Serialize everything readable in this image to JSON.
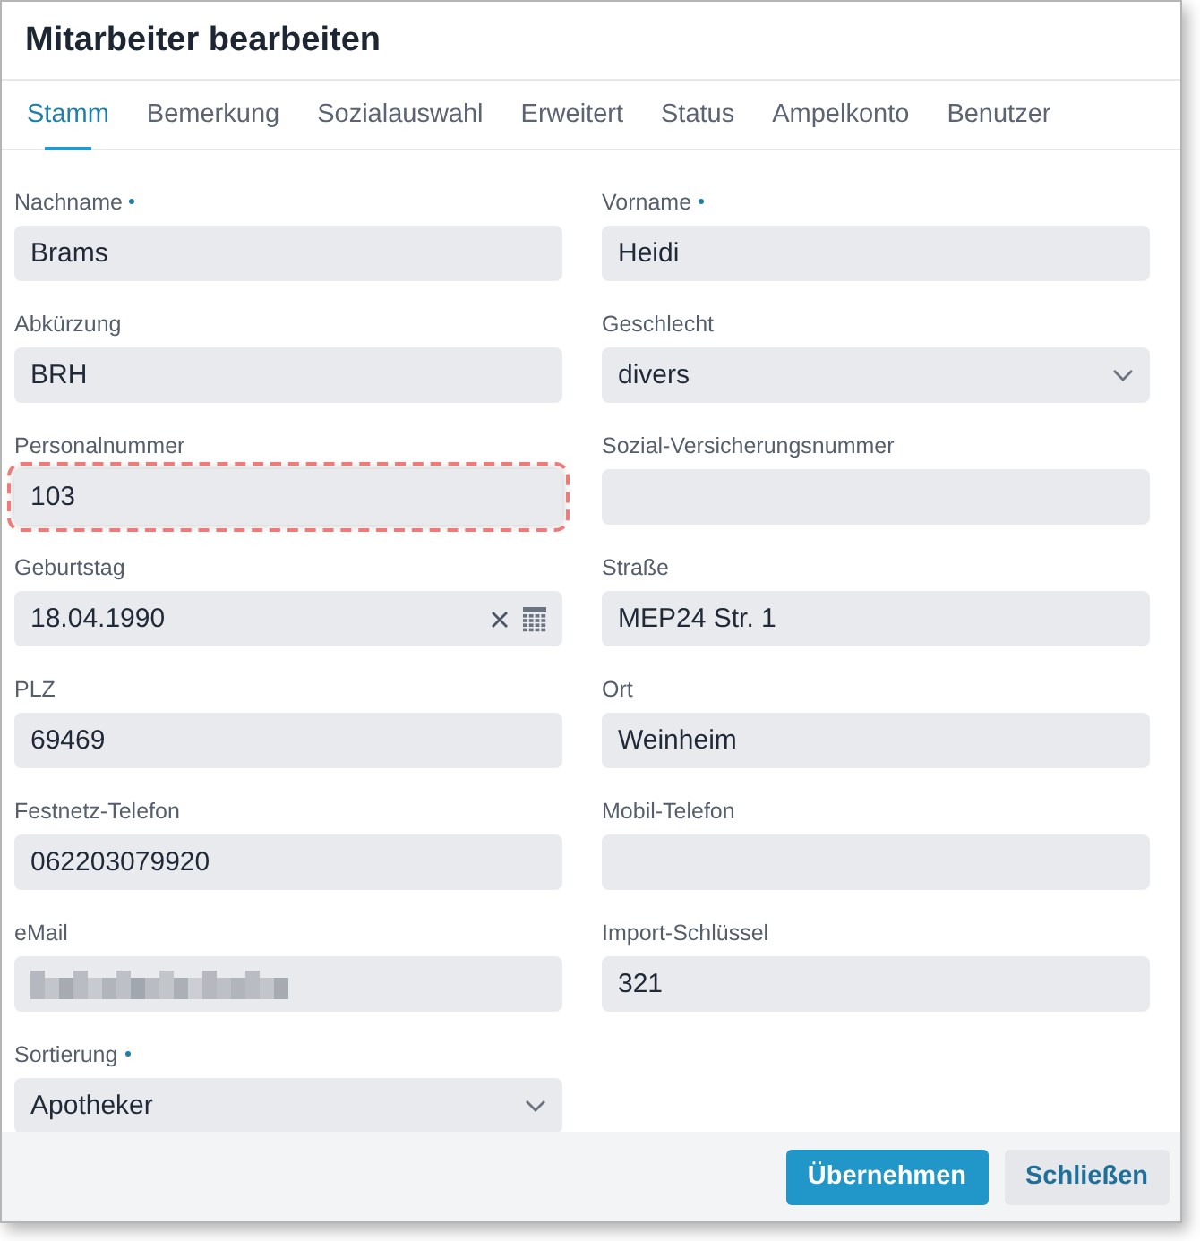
{
  "window": {
    "title": "Mitarbeiter bearbeiten"
  },
  "tabs": [
    {
      "label": "Stamm",
      "selected": true
    },
    {
      "label": "Bemerkung",
      "selected": false
    },
    {
      "label": "Sozialauswahl",
      "selected": false
    },
    {
      "label": "Erweitert",
      "selected": false
    },
    {
      "label": "Status",
      "selected": false
    },
    {
      "label": "Ampelkonto",
      "selected": false
    },
    {
      "label": "Benutzer",
      "selected": false
    }
  ],
  "fields": [
    {
      "label": "Nachname",
      "required": true,
      "kind": "text",
      "value": "Brams",
      "highlighted": false
    },
    {
      "label": "Vorname",
      "required": true,
      "kind": "text",
      "value": "Heidi",
      "highlighted": false
    },
    {
      "label": "Abkürzung",
      "required": false,
      "kind": "text",
      "value": "BRH",
      "highlighted": false
    },
    {
      "label": "Geschlecht",
      "required": false,
      "kind": "select",
      "value": "divers",
      "highlighted": false
    },
    {
      "label": "Personalnummer",
      "required": false,
      "kind": "text",
      "value": "103",
      "highlighted": true
    },
    {
      "label": "Sozial-Versicherungsnummer",
      "required": false,
      "kind": "text",
      "highlighted": false
    },
    {
      "label": "Geburtstag",
      "required": false,
      "kind": "date",
      "value": "18.04.1990",
      "highlighted": false
    },
    {
      "label": "Straße",
      "required": false,
      "kind": "text",
      "value": "MEP24 Str. 1",
      "highlighted": false
    },
    {
      "label": "PLZ",
      "required": false,
      "kind": "text",
      "value": "69469",
      "highlighted": false
    },
    {
      "label": "Ort",
      "required": false,
      "kind": "text",
      "value": "Weinheim",
      "highlighted": false
    },
    {
      "label": "Festnetz-Telefon",
      "required": false,
      "kind": "text",
      "value": "062203079920",
      "highlighted": false
    },
    {
      "label": "Mobil-Telefon",
      "required": false,
      "kind": "text",
      "highlighted": false
    },
    {
      "label": "eMail",
      "required": false,
      "kind": "redacted",
      "highlighted": false
    },
    {
      "label": "Import-Schlüssel",
      "required": false,
      "kind": "text",
      "value": "321",
      "highlighted": false
    },
    {
      "label": "Sortierung",
      "required": true,
      "kind": "select",
      "value": "Apotheker",
      "highlighted": false
    }
  ],
  "buttons": [
    {
      "label": "Übernehmen",
      "kind": "primary"
    },
    {
      "label": "Schließen",
      "kind": "secondary"
    }
  ]
}
